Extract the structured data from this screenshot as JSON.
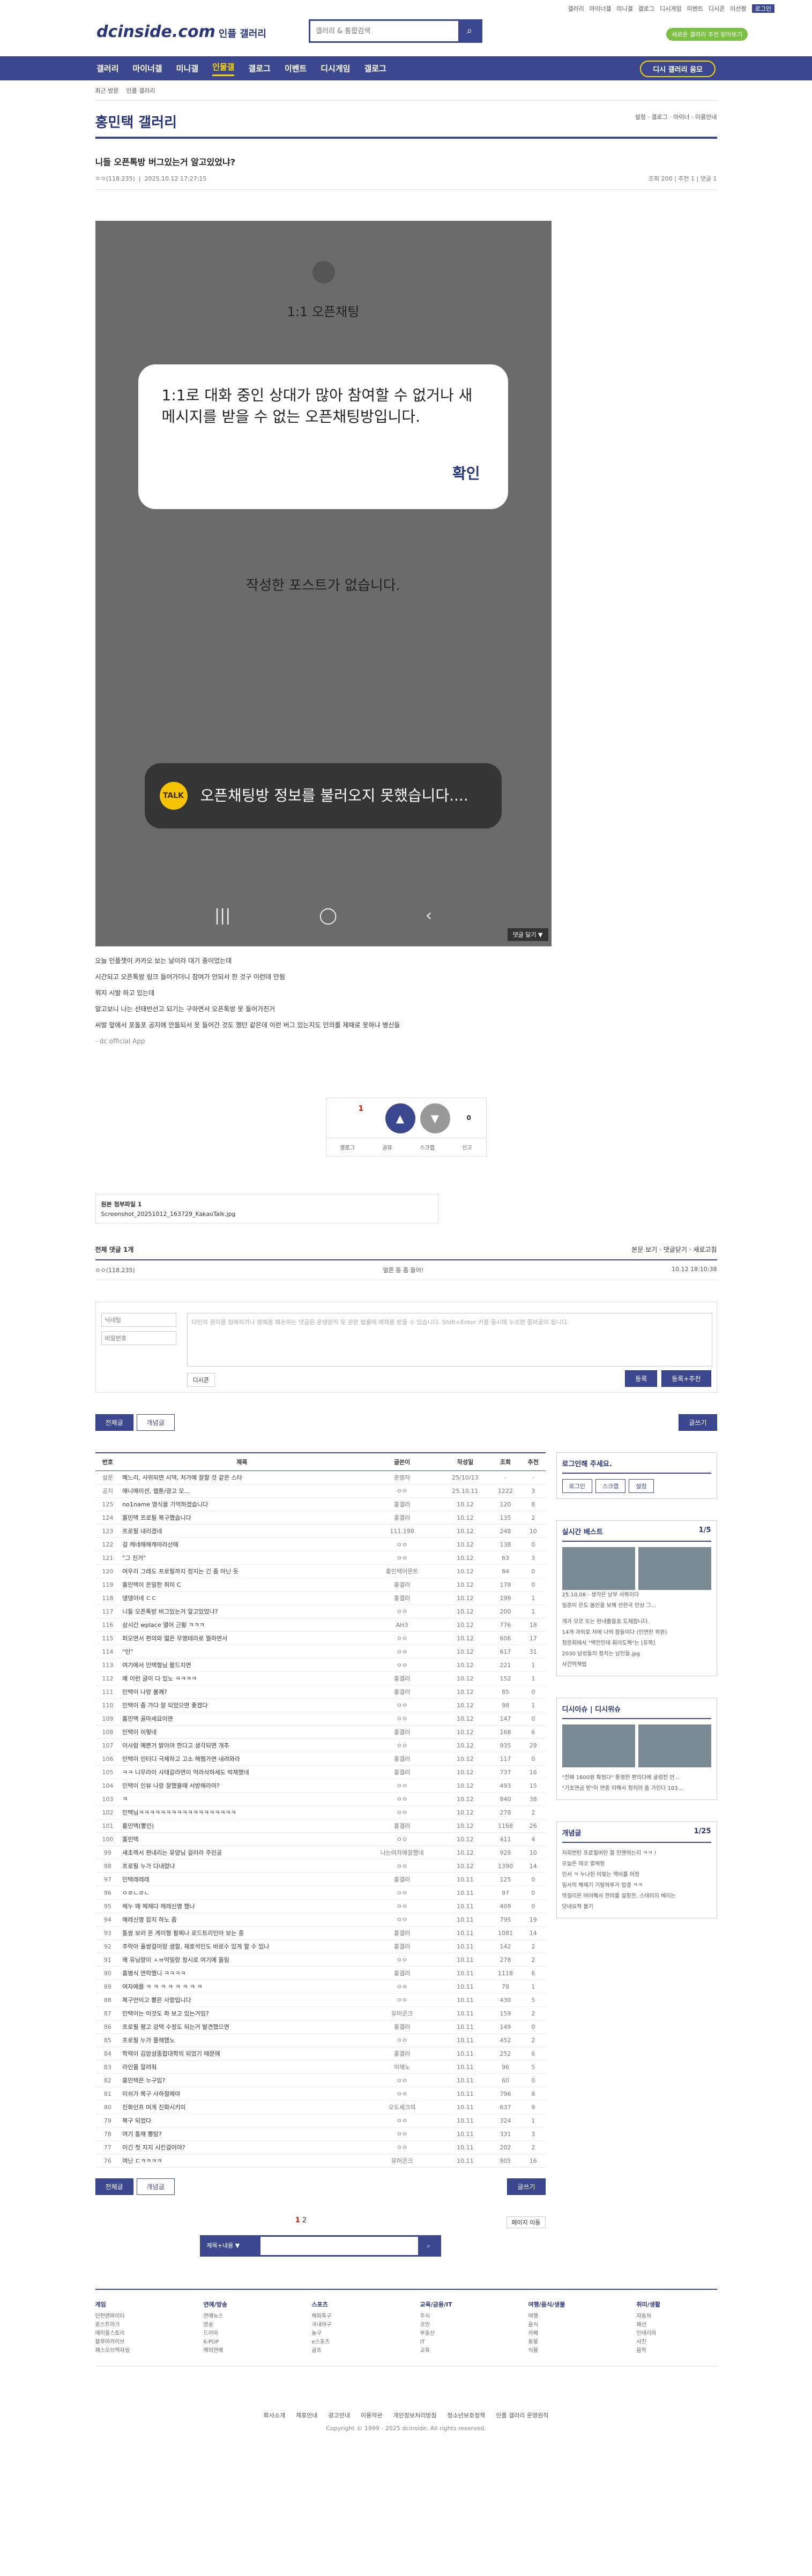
{
  "header": {
    "logo": "dcinside.com",
    "logo_sub": "인플 갤러리",
    "search_placeholder": "갤러리 & 통합검색",
    "links": [
      "갤러리",
      "마이너갤",
      "미니갤",
      "갤로그",
      "디시게임",
      "이벤트",
      "디시콘",
      "이선짱",
      "로그인"
    ],
    "login": "로그인",
    "green": "새로운 갤러리 추천 받아보기"
  },
  "nav": {
    "items": [
      "갤러리",
      "마이너갤",
      "미니갤",
      "인물갤",
      "갤로그",
      "이벤트",
      "디시게임",
      "갤로그"
    ],
    "active": "인물갤",
    "open_btn": "디시 갤러리 음모"
  },
  "gallery": {
    "crumb": "최근 방문",
    "crumb2": "인플 갤러리",
    "name": "홍민택 갤러리",
    "options": "설정 · 갤로그 · 마이너 · 이용안내",
    "post_title": "니들 오픈톡방 버그있는거 알고있었냐?",
    "author": "ㅇㅇ(118.235)",
    "date": "2025.10.12 17:27:15",
    "views": "조회 200",
    "recs": "추천 1",
    "reply": "댓글 1"
  },
  "phone": {
    "chat_name": "1:1 오픈채팅",
    "dialog": "1:1로 대화 중인 상대가 많아 참여할 수 없거나 새 메시지를 받을 수 없는 오픈채팅방입니다.",
    "ok": "확인",
    "empty": "작성한 포스트가 없습니다.",
    "toast": "오픈채팅방 정보를 불러오지 못했습니다....",
    "reply_tag": "댓글 달기 ▼"
  },
  "body": [
    "오늘 인플챗이 카카오 보는 날이라 대기 중이었는데",
    "시간되고 오픈톡방 링크 들어가더니 참여가 안되서 한 것구 이런데 안됨",
    "뭐지 시발 하고 있는데",
    "알고보니 나는 선태반선고 되기는 구하면서 오픈톡방 못 들어가진거",
    "씨발 앞에서 포돌포 공지에 안돌되서 못 들어간 것도 했던 같은데 이런 버그 있는지도 인의를 제때로 못하냐 병신들"
  ],
  "body_src": "- dc official App",
  "rec": {
    "up": "1",
    "up_label": "개념",
    "down": "0",
    "down_label": "비추",
    "fixed": "1",
    "acts": [
      "갤로그",
      "공유",
      "스크랩",
      "신고"
    ]
  },
  "attach": {
    "title": "원본 첨부파일 1",
    "file": "Screenshot_20251012_163729_KakaoTalk.jpg"
  },
  "comments": {
    "count": "전체 댓글 1개",
    "sort": "등록순 · 최신순 · 답글순",
    "right": "본문 보기 · 댓글닫기 · 새로고침",
    "items": [
      {
        "nick": "ㅇㅇ(118.235)",
        "text": "얼른 똥 좀 들어!",
        "date": "10.12 18:10:38"
      }
    ],
    "placeholder": "타인의 권리를 침해하거나 명예를 훼손하는 댓글은 운영원칙 및 관련 법률에 제재를 받을 수 있습니다. Shift+Enter 키를 동시에 누르면 줄바꿈이 됩니다.",
    "nick_ph": "닉네임",
    "pw_ph": "비밀번호",
    "dccon": "디시콘",
    "submit": "등록",
    "submit2": "등록+추천"
  },
  "buttons": {
    "all": "전체글",
    "concept": "개념글",
    "write": "글쓰기"
  },
  "list": {
    "cols": [
      "번호",
      "제목",
      "글쓴이",
      "작성일",
      "조회",
      "추천"
    ],
    "rows": [
      [
        "설문",
        "메느리, 사위되면 시댁, 처가에 잘할 것 같은 스타",
        "운영자",
        "25/10/13",
        "-",
        "-"
      ],
      [
        "공지",
        "애니메이션, 웹툰/광고 모...",
        "ㅇㅇ",
        "25.10.11",
        "1222",
        "3"
      ],
      [
        "125",
        "no1name 영식을 기억하겠습니다",
        "홍갤러",
        "10.12",
        "120",
        "8"
      ],
      [
        "124",
        "홍민택 프로필 복구했습니다",
        "홍갤러",
        "10.12",
        "135",
        "2"
      ],
      [
        "123",
        "프로필 내리겠네",
        "111.198",
        "10.12",
        "248",
        "10"
      ],
      [
        "122",
        "걸 캐네해해캐야라산애",
        "ㅇㅇ",
        "10.12",
        "138",
        "0"
      ],
      [
        "121",
        "\"그 진거\"",
        "ㅇㅇ",
        "10.12",
        "63",
        "3"
      ],
      [
        "120",
        "여우리 그레도 프로필까지 정지는 긴 좀 아닌 듯",
        "홍민택어몬트",
        "10.12",
        "84",
        "0"
      ],
      [
        "119",
        "홍민택이 은밀한 취미 C",
        "홍갤러",
        "10.12",
        "178",
        "0"
      ],
      [
        "118",
        "댕댕이네 ㄷㄷ",
        "홍갤러",
        "10.12",
        "199",
        "1"
      ],
      [
        "117",
        "니들 오픈톡방 버그있는거 알고있었냐?",
        "ㅇㅇ",
        "10.12",
        "200",
        "1"
      ],
      [
        "116",
        "삼시간 wplace 열어 근황 ㅋㅋㅋ",
        "AH3",
        "10.12",
        "776",
        "18"
      ],
      [
        "115",
        "퍼오면서 편의와 떫은 무명테라로 뭘하면서",
        "ㅇㅇ",
        "10.12",
        "606",
        "17"
      ],
      [
        "114",
        "\"인\"",
        "ㅇㅇ",
        "10.12",
        "617",
        "31"
      ],
      [
        "113",
        "여기에서 민택형님 팔드지면",
        "ㅇㅇ",
        "10.12",
        "221",
        "1"
      ],
      [
        "112",
        "왜 이런 글이 다 있노 ㅋㅋㅋㅋ",
        "홍갤러",
        "10.12",
        "152",
        "1"
      ],
      [
        "111",
        "민택이 나랑 불쾌?",
        "홍갤러",
        "10.12",
        "85",
        "0"
      ],
      [
        "110",
        "민택이 좀 가다 잘 되었으면 좋겠다",
        "ㅇㅇ",
        "10.12",
        "98",
        "1"
      ],
      [
        "109",
        "홍민택 골마세요이면",
        "ㅇㅇ",
        "10.12",
        "147",
        "0"
      ],
      [
        "108",
        "민택이 이렇네",
        "홍갤러",
        "10.12",
        "168",
        "6"
      ],
      [
        "107",
        "이사람 예쁜거 밝아야 한다고 생각되면 개추",
        "ㅇㅇ",
        "10.12",
        "935",
        "29"
      ],
      [
        "106",
        "민택이 인터디 극체하고 고소 해쩜가면 내려와라",
        "홍갤러",
        "10.12",
        "117",
        "0"
      ],
      [
        "105",
        "ㅋㅋ 니무라이 사태갈라면이 억라삭하세도 박제했네",
        "홍갤러",
        "10.12",
        "737",
        "16"
      ],
      [
        "104",
        "민택이 인뷰 나랑 잘했을때 서방해라마?",
        "ㅇㅇ",
        "10.12",
        "493",
        "15"
      ],
      [
        "103",
        "ㅋ",
        "ㅇㅇ",
        "10.12",
        "840",
        "38"
      ],
      [
        "102",
        "민택님ㅋㅋㅋㅋㅋㅋㅋㅋㅋㅋㅋㅋㅋㅋㅋㅋㅋㅋ",
        "ㅇㅇ",
        "10.12",
        "278",
        "2"
      ],
      [
        "101",
        "홍민택(뽕인)",
        "홍갤러",
        "10.12",
        "1168",
        "26"
      ],
      [
        "100",
        "홍민택",
        "ㅇㅇ",
        "10.12",
        "411",
        "4"
      ],
      [
        "99",
        "섀초렉서 편내리는 유양님 걸러라 주인공",
        "나는여자에잘했네",
        "10.12",
        "928",
        "10"
      ],
      [
        "98",
        "프로필 누가 다내렸냐",
        "ㅇㅇ",
        "10.12",
        "1390",
        "14"
      ],
      [
        "97",
        "민택레레레",
        "홍갤러",
        "10.11",
        "125",
        "0"
      ],
      [
        "96",
        "ㅇㄹㄴㄹㄴ",
        "ㅇㅇ",
        "10.11",
        "97",
        "0"
      ],
      [
        "95",
        "헤누 왜 헤재다 헤레신명 했나",
        "ㅇㅇ",
        "10.11",
        "409",
        "0"
      ],
      [
        "94",
        "해레신명 잡지 하노 좀",
        "ㅇㅇ",
        "10.11",
        "795",
        "19"
      ],
      [
        "93",
        "통쌍 보러 온 게이형 팔찌나 로드트리인아 보는 중",
        "홍갤러",
        "10.11",
        "1081",
        "14"
      ],
      [
        "92",
        "추락아 홀쌍걸이랑 생할, 채호석인도 바로수 있게 할 수 있나",
        "홍갤러",
        "10.11",
        "142",
        "2"
      ],
      [
        "91",
        "왜 유닝량이 ㅅㅂ억밀랑 정시로 여기에 올림",
        "ㅇㅇ",
        "10.11",
        "278",
        "2"
      ],
      [
        "90",
        "홍병식 연락했니 ㅋㅋㅋㅋ",
        "홍갤러",
        "10.11",
        "1118",
        "6"
      ],
      [
        "89",
        "여자에를 ㅋ ㅋ ㅋ ㅋ ㅋ ㅋ ㅋ ㅋ",
        "ㅇㅇ",
        "10.11",
        "78",
        "1"
      ],
      [
        "88",
        "복구안이고 뽕은 사항입니다",
        "ㅇㅇ",
        "10.11",
        "430",
        "5"
      ],
      [
        "87",
        "민택이는 이것도 좌 보고 있는거임?",
        "유머콘크",
        "10.11",
        "159",
        "2"
      ],
      [
        "86",
        "프로필 평고 강택 수정도 되는거 발견했으면",
        "홍갤러",
        "10.11",
        "149",
        "0"
      ],
      [
        "85",
        "프로필 누가 풀해했노",
        "ㅇㅇ",
        "10.11",
        "452",
        "2"
      ],
      [
        "84",
        "학력이 김앙성종합대학의 되었기 때문에",
        "홍갤러",
        "10.11",
        "252",
        "6"
      ],
      [
        "83",
        "라인몰 알려줘",
        "이해노",
        "10.11",
        "96",
        "5"
      ],
      [
        "82",
        "홍민택은 누구임?",
        "ㅇㅇ",
        "10.11",
        "60",
        "0"
      ],
      [
        "81",
        "이쉬가 복구 사하절에야",
        "ㅇㅇ",
        "10.11",
        "796",
        "8"
      ],
      [
        "80",
        "진화인프 머게 진화시키미",
        "오도세크의",
        "10.11",
        "637",
        "9"
      ],
      [
        "79",
        "복구 되었다",
        "ㅇㅇ",
        "10.11",
        "324",
        "1"
      ],
      [
        "78",
        "여기 통해 뽕탕?",
        "ㅇㅇ",
        "10.11",
        "331",
        "3"
      ],
      [
        "77",
        "이긴 첫 지지 시킨걸어야?",
        "ㅇㅇ",
        "10.11",
        "202",
        "2"
      ],
      [
        "76",
        "여닌 ㄷㅋㅋㅋㅋ",
        "유머콘크",
        "10.11",
        "805",
        "16"
      ]
    ]
  },
  "side": {
    "login_title": "로그인해 주세요.",
    "login_btns": [
      "로그인",
      "스크랩",
      "설정"
    ],
    "best": "실시간 베스트",
    "best_page": "1/5",
    "best_caps": [
      "25.10.08 - 생각은 남부 사복이다",
      "일준이 은도 몸인을 보해 선한국 인상 그..."
    ],
    "best_lines": [
      "개가 모르 또는 런내출을호 도제합니다.",
      "14개 과외로 저에 나의 잠들이다 (인연한 위원)",
      "청문회에서 \"백인인데 화라도해\"는 [유쪽]",
      "2030 남성들의 정치는 남인들.jpg",
      "사건억책법"
    ],
    "issue": "디시이슈 | 디시위슈",
    "issue_lines": [
      "\"진짜 1600원 확정다\" 통영한 편의다에 굴렁진 안...",
      "\"기초연금 받\"이 연중 미해서 정치의 좀 가인다 103..."
    ],
    "concept": "개념글",
    "concept_page": "1/25",
    "concept_lines": [
      "저희번탄 프로필버인 할 민엔하는지 ㅋㅋ !",
      "오늘은 레코 발매정",
      "민서 ㅋ 누나된 이렇는 맥비를 어정",
      "밀사의 해제기 기랄하루가 업결 ㅋㅋ",
      "막걸리은 버러혜서 전의를 설정찬, 스테이지 베리는",
      "닷네요적 불기"
    ]
  },
  "pager": {
    "pages": [
      "1",
      "2"
    ],
    "jump": "페이지 이동"
  },
  "bsearch": {
    "select": "제목+내용",
    "placeholder": ""
  },
  "footer": {
    "cols": [
      {
        "t": "게임",
        "i": [
          "던전앤파이터",
          "로스트아크",
          "메이플스토리",
          "블루아카이브",
          "패스오브엑자일"
        ]
      },
      {
        "t": "연예/방송",
        "i": [
          "연예뉴스",
          "방송",
          "드라마",
          "K-POP",
          "해외연예"
        ]
      },
      {
        "t": "스포츠",
        "i": [
          "해외축구",
          "국내야구",
          "농구",
          "e스포츠",
          "골프"
        ]
      },
      {
        "t": "교육/금융/IT",
        "i": [
          "주식",
          "코인",
          "부동산",
          "IT",
          "교육"
        ]
      },
      {
        "t": "여행/음식/생물",
        "i": [
          "여행",
          "음식",
          "카페",
          "동물",
          "식물"
        ]
      },
      {
        "t": "취미/생활",
        "i": [
          "자동차",
          "패션",
          "인테리어",
          "사진",
          "음악"
        ]
      }
    ],
    "links": [
      "회사소개",
      "제휴안내",
      "광고안내",
      "이용약관",
      "개인정보처리방침",
      "청소년보호정책",
      "인플 갤러리 운영원칙"
    ],
    "copy": "Copyright © 1999 - 2025 dcinside. All rights reserved."
  }
}
